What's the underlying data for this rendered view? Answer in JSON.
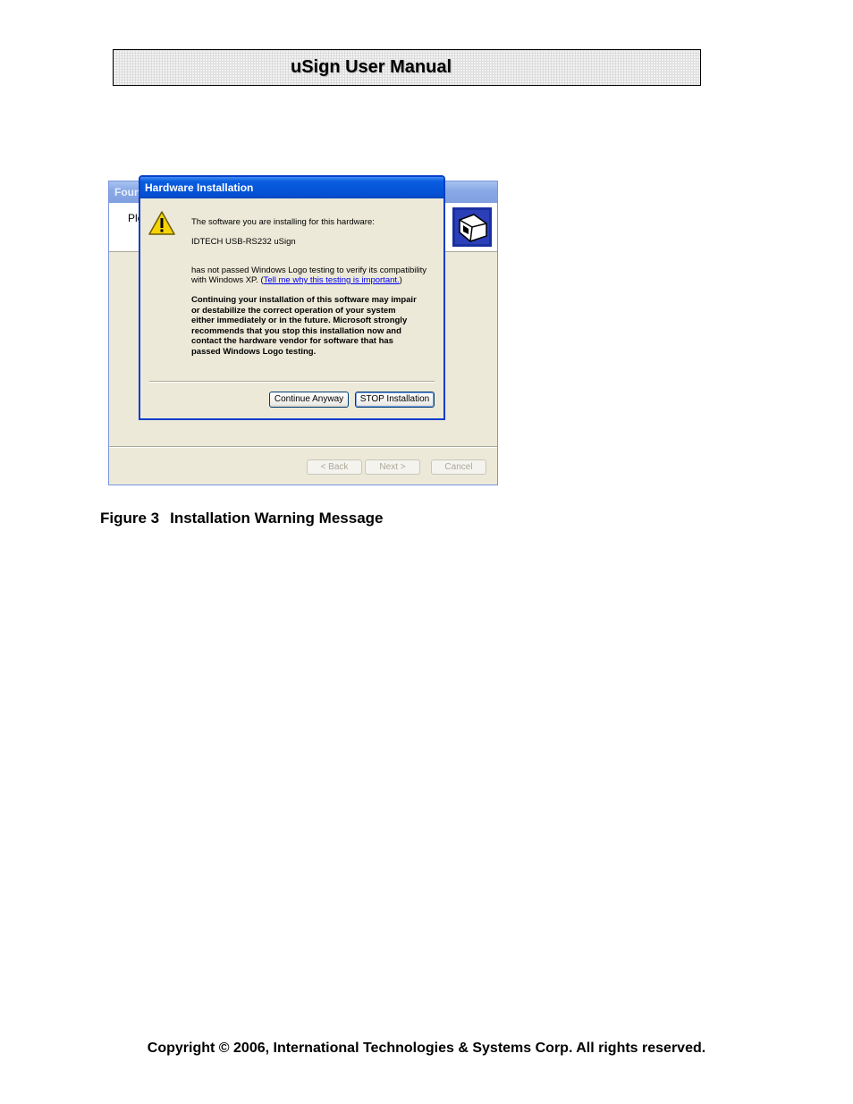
{
  "header": {
    "title": "uSign User Manual"
  },
  "wizard": {
    "title": "Foun",
    "header_text": "Ple",
    "buttons": {
      "back": "< Back",
      "next": "Next >",
      "cancel": "Cancel"
    }
  },
  "dialog": {
    "title": "Hardware Installation",
    "line1": "The software you are installing for this hardware:",
    "device": "IDTECH USB-RS232 uSign",
    "logo_line1": "has not passed Windows Logo testing to verify its compatibility",
    "logo_line2_prefix": "with Windows XP. (",
    "logo_link": "Tell me why this testing is important.",
    "logo_line2_suffix": ")",
    "warning_lines": [
      "Continuing your installation of this software may impair",
      "or destabilize the correct operation of your system",
      "either immediately or in the future. Microsoft strongly",
      "recommends that you stop this installation now and",
      "contact the hardware vendor for software that has",
      "passed Windows Logo testing."
    ],
    "buttons": {
      "continue": "Continue Anyway",
      "stop": "STOP Installation"
    }
  },
  "caption": {
    "label": "Figure 3",
    "text": "Installation Warning Message"
  },
  "footer": {
    "copyright": "Copyright © 2006, International Technologies & Systems Corp. All rights reserved."
  }
}
